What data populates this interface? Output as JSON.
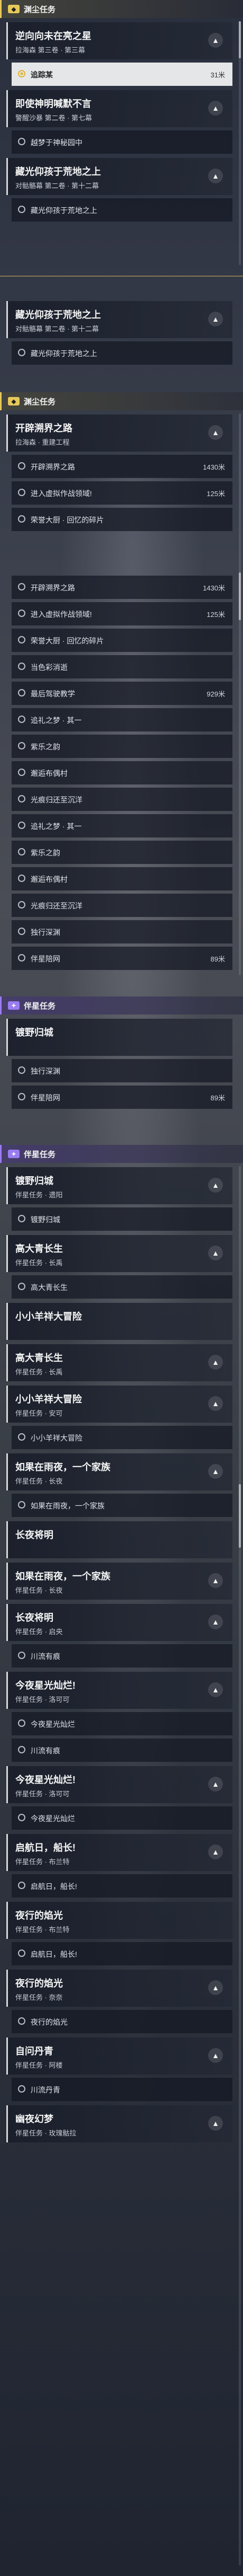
{
  "sections": {
    "s1": {
      "title": "渊尘任务",
      "badge": "◆"
    },
    "s2": {
      "title": "渊尘任务",
      "badge": "◆"
    },
    "s3": {
      "title": "伴星任务",
      "badge": "✦"
    },
    "s4": {
      "title": "伴星任务",
      "badge": "✦"
    }
  },
  "quests": {
    "q1": {
      "title": "逆向向未在亮之星",
      "subtitle": "拉海森 第三卷 · 第三幕"
    },
    "q2": {
      "title": "即使神明喊默不言",
      "subtitle": "警醒沙暴 第二卷 · 第七幕"
    },
    "q3": {
      "title": "藏光仰孩于荒地之上",
      "subtitle": "对骷骼幕 第二卷 · 第十二幕"
    },
    "q4": {
      "title": "藏光仰孩于荒地之上",
      "subtitle": "对骷骼幕 第二卷 · 第十二幕"
    },
    "q5": {
      "title": "开辟溯界之路",
      "subtitle": "拉海森 · 重建工程"
    },
    "q6": {
      "title": "镀野归城",
      "subtitle": ""
    },
    "q7": {
      "title": "镀野归城",
      "subtitle": "伴星任务 · 遗阳"
    },
    "q8": {
      "title": "高大青长生",
      "subtitle": "伴星任务 · 长禹"
    },
    "q9": {
      "title": "小小羊祥大冒险",
      "subtitle": ""
    },
    "q10": {
      "title": "高大青长生",
      "subtitle": "伴星任务 · 长禹"
    },
    "q11": {
      "title": "小小羊祥大冒险",
      "subtitle": "伴星任务 · 安可"
    },
    "q12": {
      "title": "如果在雨夜，一个家族",
      "subtitle": "伴星任务 · 长夜"
    },
    "q13": {
      "title": "长夜将明",
      "subtitle": ""
    },
    "q14": {
      "title": "如果在雨夜，一个家族",
      "subtitle": "伴星任务 · 长夜"
    },
    "q15": {
      "title": "长夜将明",
      "subtitle": "伴星任务 · 启央"
    },
    "q16": {
      "title": "今夜星光灿烂!",
      "subtitle": "伴星任务 · 洛可可"
    },
    "q17": {
      "title": "今夜星光灿烂!",
      "subtitle": "伴星任务 · 洛可可"
    },
    "q18": {
      "title": "启航日，船长!",
      "subtitle": "伴星任务 · 布兰特"
    },
    "q19": {
      "title": "夜行的焰光",
      "subtitle": "伴星任务 · 布兰特"
    },
    "q20": {
      "title": "夜行的焰光",
      "subtitle": "伴星任务 · 奈奈"
    },
    "q21": {
      "title": "自问丹青",
      "subtitle": "伴星任务 · 阿楼"
    },
    "q22": {
      "title": "幽夜幻梦",
      "subtitle": "伴星任务 · 玫瑰骷拉"
    }
  },
  "steps": {
    "a1": {
      "label": "追踪某",
      "dist": "31米"
    },
    "a2": {
      "label": "越梦于神秘园中",
      "dist": ""
    },
    "a3": {
      "label": "藏光仰孩于荒地之上",
      "dist": ""
    },
    "a4": {
      "label": "藏光仰孩于荒地之上",
      "dist": ""
    },
    "b1": {
      "label": "开辟溯界之路",
      "dist": "1430米"
    },
    "b2": {
      "label": "进入虚拟作战领域!",
      "dist": "125米"
    },
    "b3": {
      "label": "荣誉大厨 · 回忆的碎片",
      "dist": ""
    },
    "b4": {
      "label": "开辟溯界之路",
      "dist": "1430米"
    },
    "b5": {
      "label": "进入虚拟作战领域!",
      "dist": "125米"
    },
    "b6": {
      "label": "荣誉大厨 · 回忆的碎片",
      "dist": ""
    },
    "b7": {
      "label": "当色彩消逝",
      "dist": ""
    },
    "b8": {
      "label": "最后驾驶教学",
      "dist": "929米"
    },
    "b9": {
      "label": "追礼之梦 · 其一",
      "dist": ""
    },
    "b10": {
      "label": "紫乐之韵",
      "dist": ""
    },
    "b11": {
      "label": "邂逅布偶村",
      "dist": ""
    },
    "b12": {
      "label": "光痕归还至沉洋",
      "dist": ""
    },
    "b13": {
      "label": "追礼之梦 · 其一",
      "dist": ""
    },
    "b14": {
      "label": "紫乐之韵",
      "dist": ""
    },
    "b15": {
      "label": "邂逅布偶村",
      "dist": ""
    },
    "b16": {
      "label": "光痕归还至沉洋",
      "dist": ""
    },
    "b17": {
      "label": "独行深渊",
      "dist": ""
    },
    "b18": {
      "label": "伴星陪网",
      "dist": "89米"
    },
    "c1": {
      "label": "独行深渊",
      "dist": ""
    },
    "c2": {
      "label": "伴星陪网",
      "dist": "89米"
    },
    "d1": {
      "label": "镀野归城",
      "dist": ""
    },
    "d2": {
      "label": "高大青长生",
      "dist": ""
    },
    "d3": {
      "label": "小小羊祥大冒险",
      "dist": ""
    },
    "d4": {
      "label": "如果在雨夜，一个家族",
      "dist": ""
    },
    "d5": {
      "label": "川流有痕",
      "dist": ""
    },
    "d6": {
      "label": "今夜星光灿烂",
      "dist": ""
    },
    "d7": {
      "label": "川流有痕",
      "dist": ""
    },
    "d8": {
      "label": "今夜星光灿烂",
      "dist": ""
    },
    "d9": {
      "label": "启航日，船长!",
      "dist": ""
    },
    "d10": {
      "label": "启航日，船长!",
      "dist": ""
    },
    "d11": {
      "label": "夜行的焰光",
      "dist": ""
    },
    "d12": {
      "label": "川流丹青",
      "dist": ""
    }
  }
}
